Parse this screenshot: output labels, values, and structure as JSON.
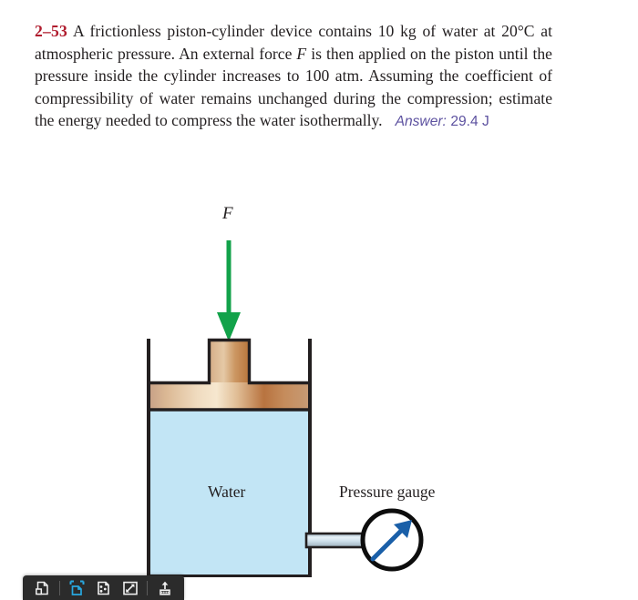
{
  "problem": {
    "number": "2–53",
    "body_part1": "A frictionless piston-cylinder device contains 10 kg of water at 20°C at atmospheric pressure. An external force ",
    "force_symbol": "F",
    "body_part2": " is then applied on the piston until the pressure inside the cylinder increases to 100 atm. Assuming the coefficient of compressibility of water remains unchanged during the compression; estimate the energy needed to compress the water isothermally.",
    "answer_label": "Answer:",
    "answer_value": "29.4 J"
  },
  "figure": {
    "force_label": "F",
    "water_label": "Water",
    "gauge_label": "Pressure gauge",
    "colors": {
      "force_arrow": "#12a24a",
      "water_fill": "#c2e5f5",
      "piston_light": "#f4dcc2",
      "piston_mid": "#c99a6e",
      "piston_dark": "#a9663a",
      "outline": "#231f20",
      "gauge_needle": "#1a5fa8",
      "tube_fill": "#cfe0ea"
    }
  },
  "toolbar": {
    "background": "#2b2b2b",
    "active_color": "#29a8e0",
    "items": [
      {
        "name": "single-page-view-icon",
        "label": "Single page view",
        "active": false
      },
      {
        "name": "fit-page-icon",
        "label": "Fit to page",
        "active": true
      },
      {
        "name": "page-thumbnails-icon",
        "label": "Page thumbnails",
        "active": false
      },
      {
        "name": "fullscreen-expand-icon",
        "label": "Expand to fullscreen",
        "active": false
      },
      {
        "name": "upload-print-icon",
        "label": "Print",
        "active": false
      }
    ]
  }
}
